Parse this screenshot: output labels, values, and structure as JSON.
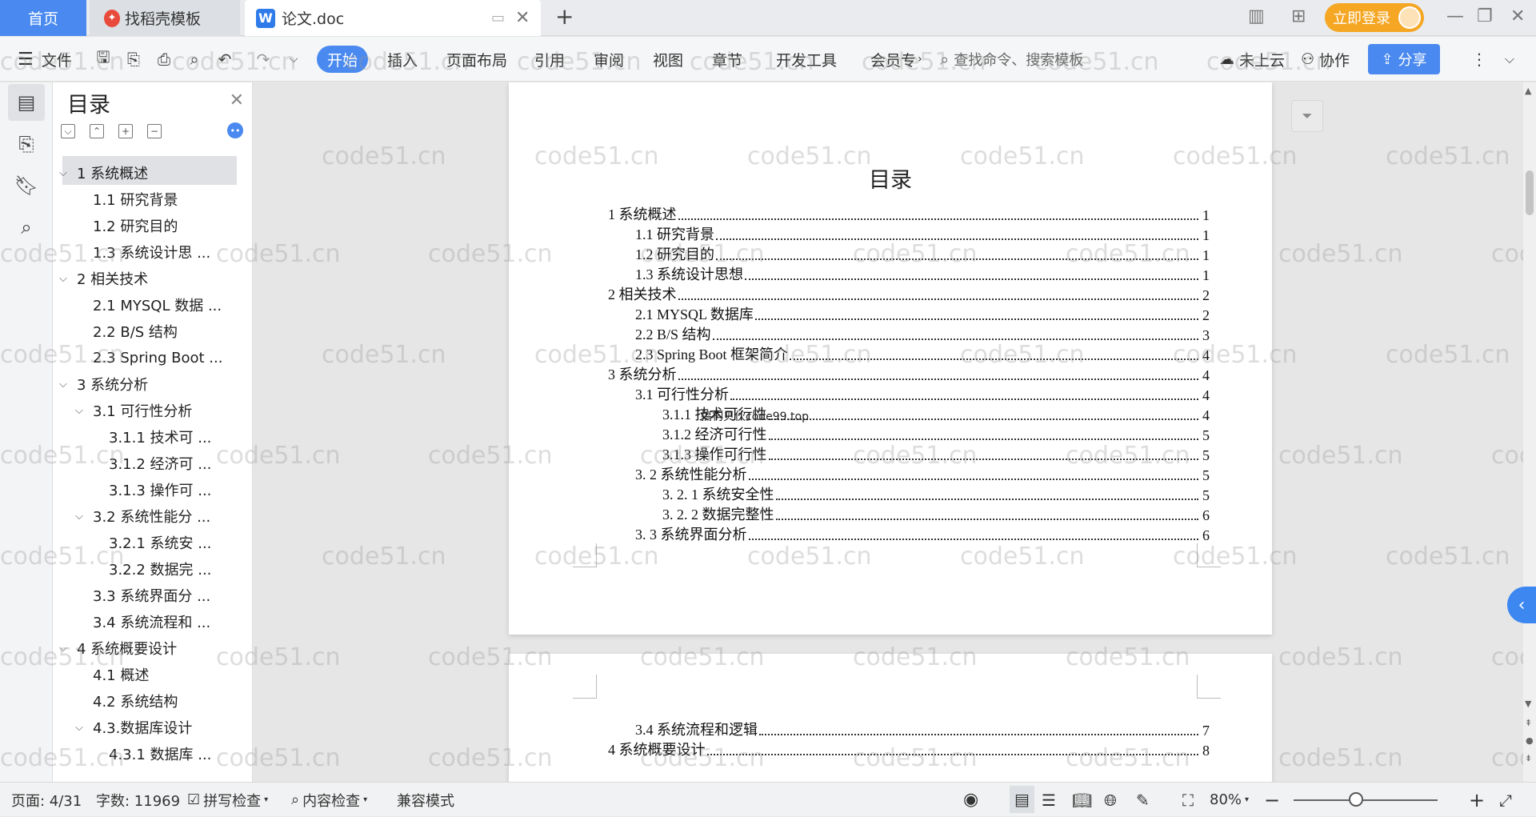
{
  "tabs": {
    "home": "首页",
    "template": "找稻壳模板",
    "doc": "论文.doc",
    "new_tab": "+"
  },
  "header": {
    "login": "立即登录"
  },
  "toolbar": {
    "file": "文件",
    "start": "开始",
    "insert": "插入",
    "layout": "页面布局",
    "reference": "引用",
    "review": "审阅",
    "view": "视图",
    "chapter": "章节",
    "devtools": "开发工具",
    "member": "会员专",
    "search_placeholder": "查找命令、搜索模板",
    "cloud": "未上云",
    "collab": "协作",
    "share": "分享"
  },
  "toc": {
    "title": "目录",
    "items": [
      {
        "label": "1 系统概述",
        "level": 1,
        "arrow": "⌵"
      },
      {
        "label": "1.1  研究背景",
        "level": 2,
        "arrow": ""
      },
      {
        "label": "1.2 研究目的",
        "level": 2,
        "arrow": ""
      },
      {
        "label": "1.3 系统设计思 ...",
        "level": 2,
        "arrow": ""
      },
      {
        "label": "2 相关技术",
        "level": 1,
        "arrow": "⌵"
      },
      {
        "label": "2.1 MYSQL 数据 ...",
        "level": 2,
        "arrow": ""
      },
      {
        "label": "2.2 B/S 结构",
        "level": 2,
        "arrow": ""
      },
      {
        "label": "2.3 Spring Boot ...",
        "level": 2,
        "arrow": ""
      },
      {
        "label": "3 系统分析",
        "level": 1,
        "arrow": "⌵"
      },
      {
        "label": "3.1 可行性分析",
        "level": 2,
        "arrow": "⌵"
      },
      {
        "label": "3.1.1 技术可 ...",
        "level": 3,
        "arrow": ""
      },
      {
        "label": "3.1.2 经济可 ...",
        "level": 3,
        "arrow": ""
      },
      {
        "label": "3.1.3 操作可 ...",
        "level": 3,
        "arrow": ""
      },
      {
        "label": "3.2 系统性能分 ...",
        "level": 2,
        "arrow": "⌵"
      },
      {
        "label": "3.2.1  系统安 ...",
        "level": 3,
        "arrow": ""
      },
      {
        "label": "3.2.2  数据完 ...",
        "level": 3,
        "arrow": ""
      },
      {
        "label": "3.3 系统界面分 ...",
        "level": 2,
        "arrow": ""
      },
      {
        "label": "3.4 系统流程和 ...",
        "level": 2,
        "arrow": ""
      },
      {
        "label": "4 系统概要设计",
        "level": 1,
        "arrow": "⌵"
      },
      {
        "label": "4.1 概述",
        "level": 2,
        "arrow": ""
      },
      {
        "label": "4.2 系统结构",
        "level": 2,
        "arrow": ""
      },
      {
        "label": "4.3.数据库设计",
        "level": 2,
        "arrow": "⌵"
      },
      {
        "label": "4.3.1 数据库 ...",
        "level": 3,
        "arrow": ""
      }
    ]
  },
  "document": {
    "title": "目录",
    "lines": [
      {
        "text": "1 系统概述",
        "page": "1",
        "indent": 0
      },
      {
        "text": "1.1  研究背景",
        "page": "1",
        "indent": 1
      },
      {
        "text": "1.2 研究目的",
        "page": "1",
        "indent": 1
      },
      {
        "text": "1.3 系统设计思想",
        "page": "1",
        "indent": 1
      },
      {
        "text": "2 相关技术",
        "page": "2",
        "indent": 0
      },
      {
        "text": "2.1 MYSQL 数据库",
        "page": "2",
        "indent": 1
      },
      {
        "text": "2.2 B/S 结构",
        "page": "3",
        "indent": 1
      },
      {
        "text": "2.3 Spring Boot 框架简介",
        "page": "4",
        "indent": 1
      },
      {
        "text": "3 系统分析",
        "page": "4",
        "indent": 0
      },
      {
        "text": "3.1 可行性分析",
        "page": "4",
        "indent": 1
      },
      {
        "text": "3.1.1 技术可行性",
        "page": "4",
        "indent": 2
      },
      {
        "text": "3.1.2 经济可行性",
        "page": "5",
        "indent": 2
      },
      {
        "text": "3.1.3 操作可行性",
        "page": "5",
        "indent": 2
      },
      {
        "text": "3. 2 系统性能分析",
        "page": "5",
        "indent": 1
      },
      {
        "text": "3. 2. 1  系统安全性",
        "page": "5",
        "indent": 2
      },
      {
        "text": "3. 2. 2  数据完整性",
        "page": "6",
        "indent": 2
      },
      {
        "text": "3. 3 系统界面分析",
        "page": "6",
        "indent": 1
      }
    ],
    "page2_lines": [
      {
        "text": "3.4 系统流程和逻辑",
        "page": "7",
        "indent": 1
      },
      {
        "text": "4 系统概要设计",
        "page": "8",
        "indent": 0
      }
    ],
    "overlay": "搞构贝伙code99.top"
  },
  "watermark": "code51.cn",
  "status": {
    "page": "页面: 4/31",
    "words": "字数: 11969",
    "spell": "拼写检查",
    "content": "内容检查",
    "compat": "兼容模式",
    "zoom": "80%"
  }
}
